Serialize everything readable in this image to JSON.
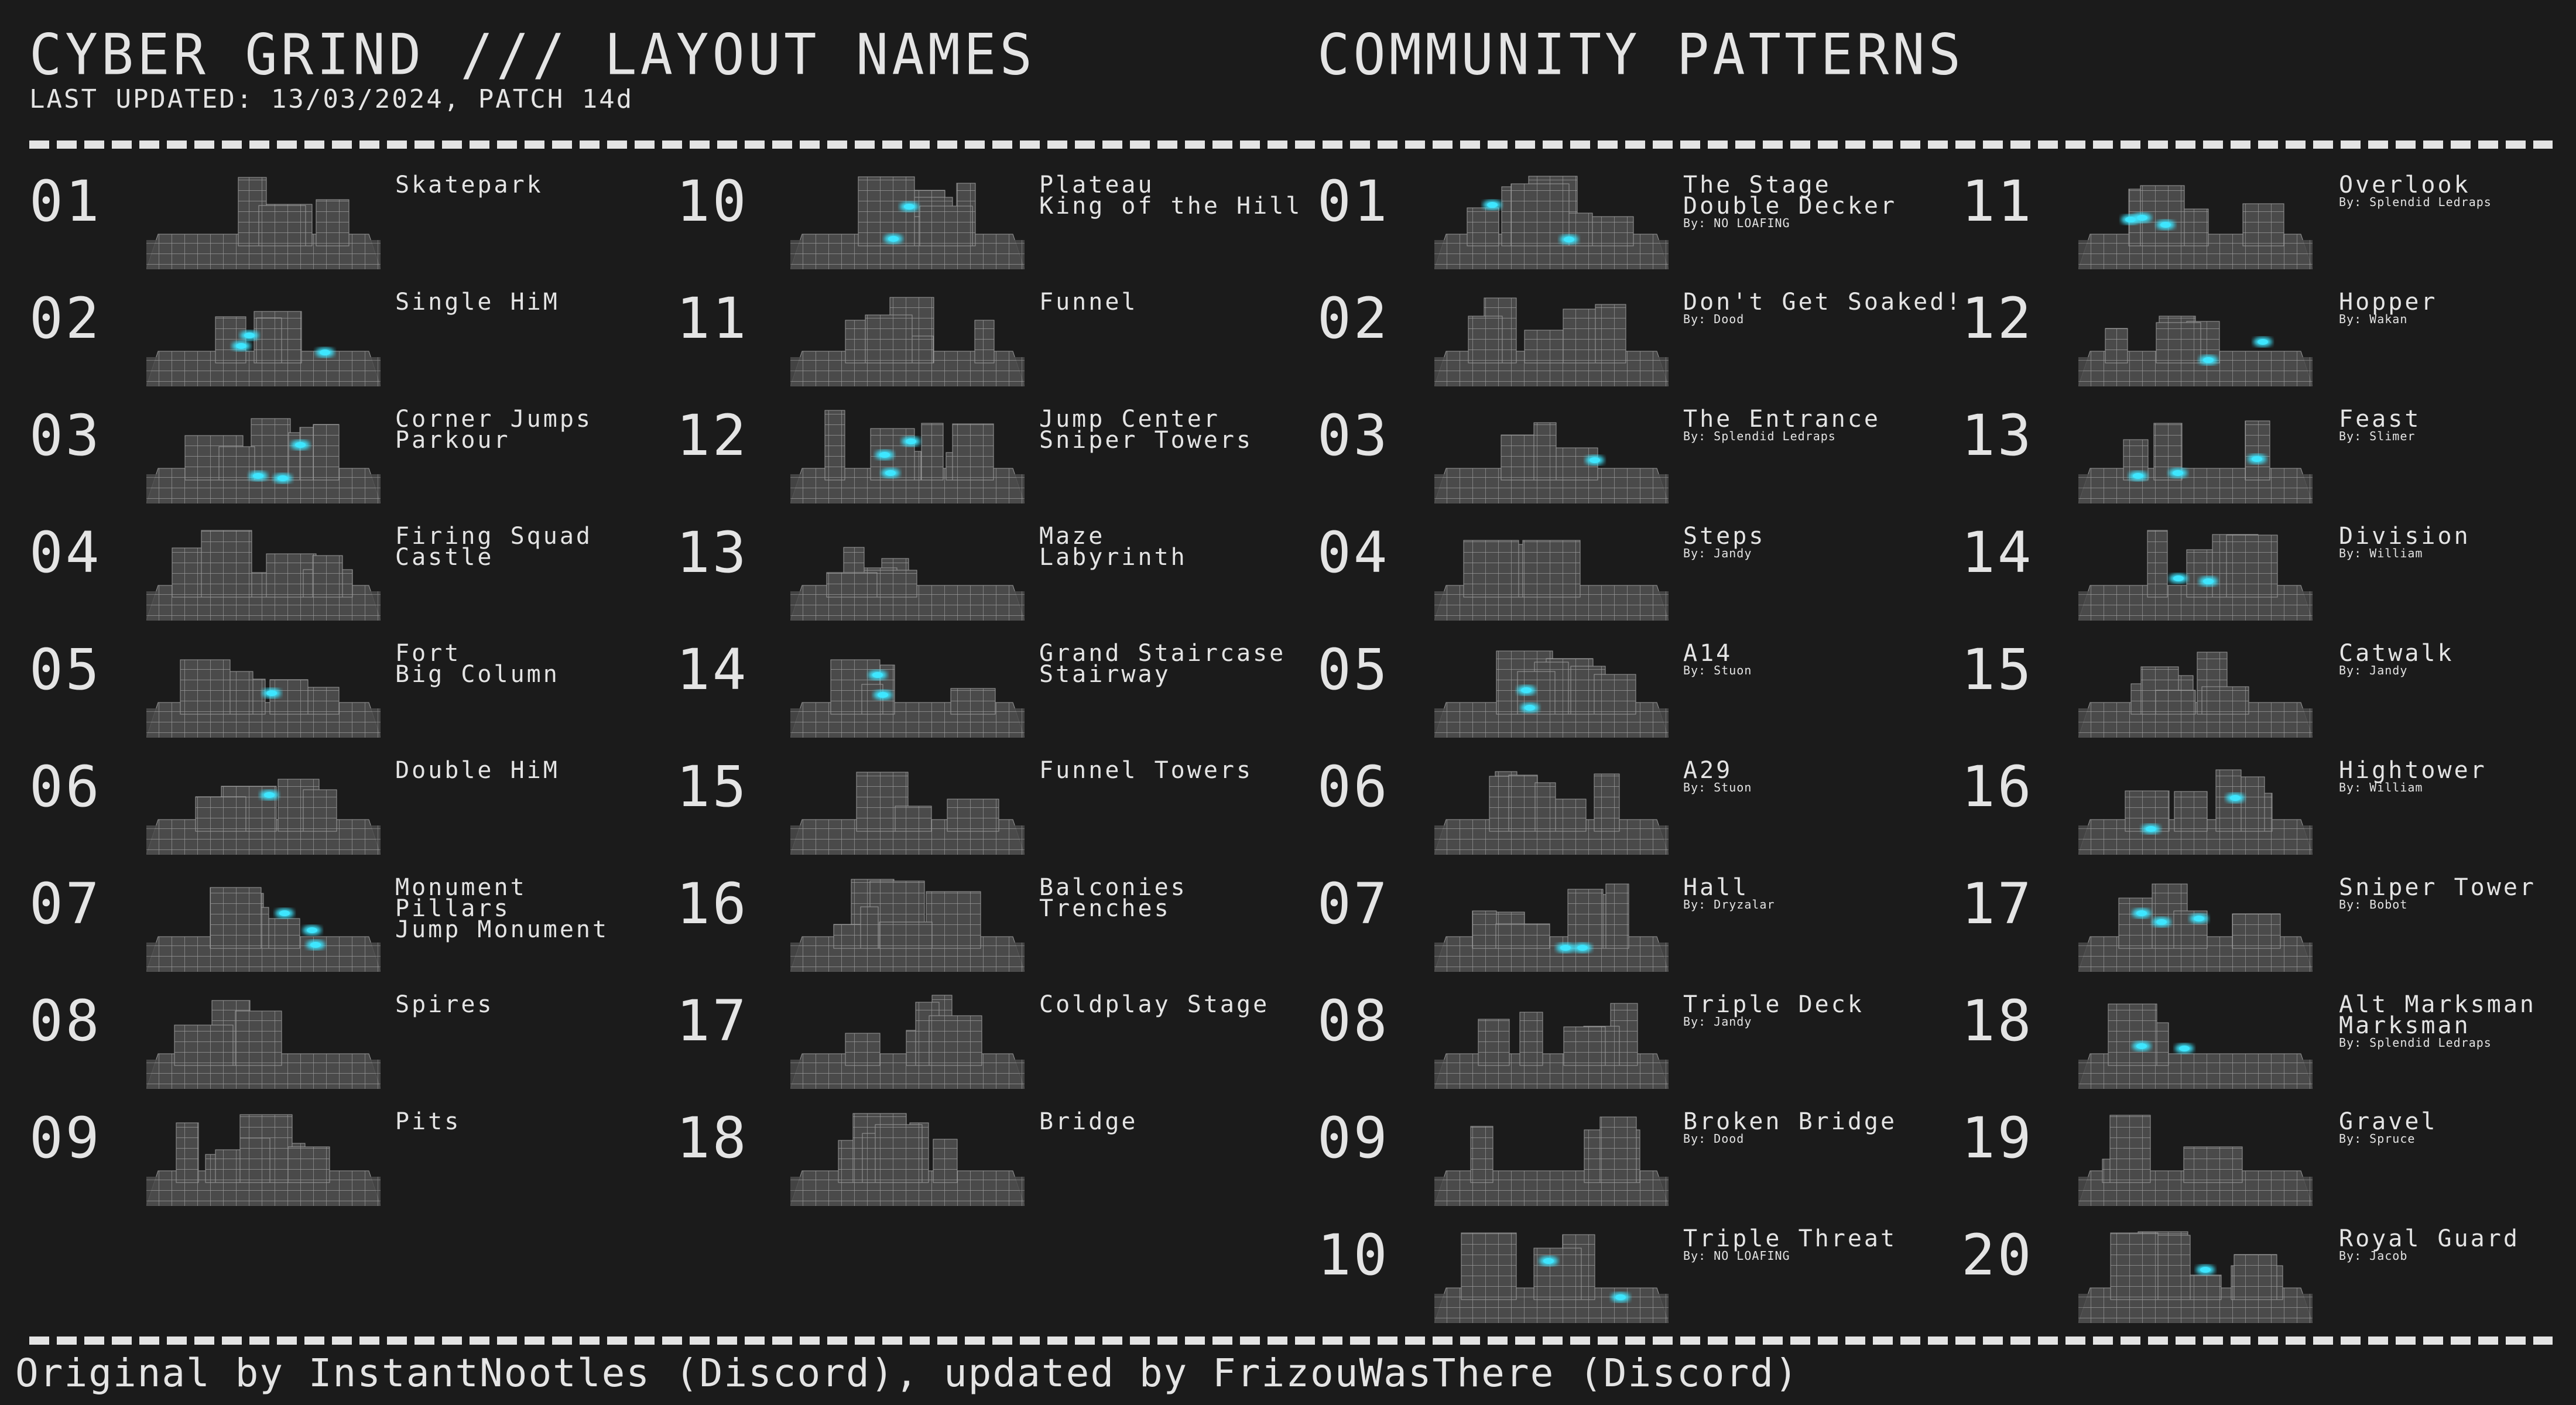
{
  "header": {
    "title_left": "CYBER GRIND /// LAYOUT NAMES",
    "title_right": "COMMUNITY PATTERNS",
    "subtitle": "LAST UPDATED: 13/03/2024, PATCH 14d"
  },
  "footer": {
    "credits": "Original by InstantNootles (Discord), updated by FrizouWasThere (Discord)"
  },
  "colors": {
    "background": "#1b1b1b",
    "text": "#e4e4e4",
    "grid_face": "#4a4a4a",
    "grid_line": "#9a9a9a",
    "glow": "#3ee6ff"
  },
  "layouts": [
    {
      "num": "01",
      "names": [
        "Skatepark"
      ],
      "glow": false
    },
    {
      "num": "02",
      "names": [
        "Single HiM"
      ],
      "glow": true
    },
    {
      "num": "03",
      "names": [
        "Corner Jumps",
        "Parkour"
      ],
      "glow": true
    },
    {
      "num": "04",
      "names": [
        "Firing Squad",
        "Castle"
      ],
      "glow": false
    },
    {
      "num": "05",
      "names": [
        "Fort",
        "Big Column"
      ],
      "glow": true
    },
    {
      "num": "06",
      "names": [
        "Double HiM"
      ],
      "glow": true
    },
    {
      "num": "07",
      "names": [
        "Monument",
        "Pillars",
        "Jump Monument"
      ],
      "glow": true
    },
    {
      "num": "08",
      "names": [
        "Spires"
      ],
      "glow": false
    },
    {
      "num": "09",
      "names": [
        "Pits"
      ],
      "glow": false
    },
    {
      "num": "10",
      "names": [
        "Plateau",
        "King of the Hill"
      ],
      "glow": true
    },
    {
      "num": "11",
      "names": [
        "Funnel"
      ],
      "glow": false
    },
    {
      "num": "12",
      "names": [
        "Jump Center",
        "Sniper Towers"
      ],
      "glow": true
    },
    {
      "num": "13",
      "names": [
        "Maze",
        "Labyrinth"
      ],
      "glow": false
    },
    {
      "num": "14",
      "names": [
        "Grand Staircase",
        "Stairway"
      ],
      "glow": true
    },
    {
      "num": "15",
      "names": [
        "Funnel Towers"
      ],
      "glow": false
    },
    {
      "num": "16",
      "names": [
        "Balconies",
        "Trenches"
      ],
      "glow": false
    },
    {
      "num": "17",
      "names": [
        "Coldplay Stage"
      ],
      "glow": false
    },
    {
      "num": "18",
      "names": [
        "Bridge"
      ],
      "glow": false
    }
  ],
  "community": [
    {
      "num": "01",
      "names": [
        "The Stage",
        "Double Decker"
      ],
      "author": "By: NO LOAFING",
      "glow": true
    },
    {
      "num": "02",
      "names": [
        "Don't Get Soaked!"
      ],
      "author": "By: Dood",
      "glow": false
    },
    {
      "num": "03",
      "names": [
        "The Entrance"
      ],
      "author": "By: Splendid Ledraps",
      "glow": true
    },
    {
      "num": "04",
      "names": [
        "Steps"
      ],
      "author": "By: Jandy",
      "glow": false
    },
    {
      "num": "05",
      "names": [
        "A14"
      ],
      "author": "By: Stuon",
      "glow": true
    },
    {
      "num": "06",
      "names": [
        "A29"
      ],
      "author": "By: Stuon",
      "glow": false
    },
    {
      "num": "07",
      "names": [
        "Hall"
      ],
      "author": "By: Dryzalar",
      "glow": true
    },
    {
      "num": "08",
      "names": [
        "Triple Deck"
      ],
      "author": "By: Jandy",
      "glow": false
    },
    {
      "num": "09",
      "names": [
        "Broken Bridge"
      ],
      "author": "By: Dood",
      "glow": false
    },
    {
      "num": "10",
      "names": [
        "Triple Threat"
      ],
      "author": "By: NO LOAFING",
      "glow": true
    },
    {
      "num": "11",
      "names": [
        "Overlook"
      ],
      "author": "By: Splendid Ledraps",
      "glow": true
    },
    {
      "num": "12",
      "names": [
        "Hopper"
      ],
      "author": "By: Wakan",
      "glow": true
    },
    {
      "num": "13",
      "names": [
        "Feast"
      ],
      "author": "By: Slimer",
      "glow": true
    },
    {
      "num": "14",
      "names": [
        "Division"
      ],
      "author": "By: William",
      "glow": true
    },
    {
      "num": "15",
      "names": [
        "Catwalk"
      ],
      "author": "By: Jandy",
      "glow": false
    },
    {
      "num": "16",
      "names": [
        "Hightower"
      ],
      "author": "By: William",
      "glow": true
    },
    {
      "num": "17",
      "names": [
        "Sniper Tower"
      ],
      "author": "By: Bobot",
      "glow": true
    },
    {
      "num": "18",
      "names": [
        "Alt Marksman",
        "Marksman"
      ],
      "author": "By: Splendid Ledraps",
      "glow": true
    },
    {
      "num": "19",
      "names": [
        "Gravel"
      ],
      "author": "By: Spruce",
      "glow": false
    },
    {
      "num": "20",
      "names": [
        "Royal Guard"
      ],
      "author": "By: Jacob",
      "glow": true
    }
  ]
}
